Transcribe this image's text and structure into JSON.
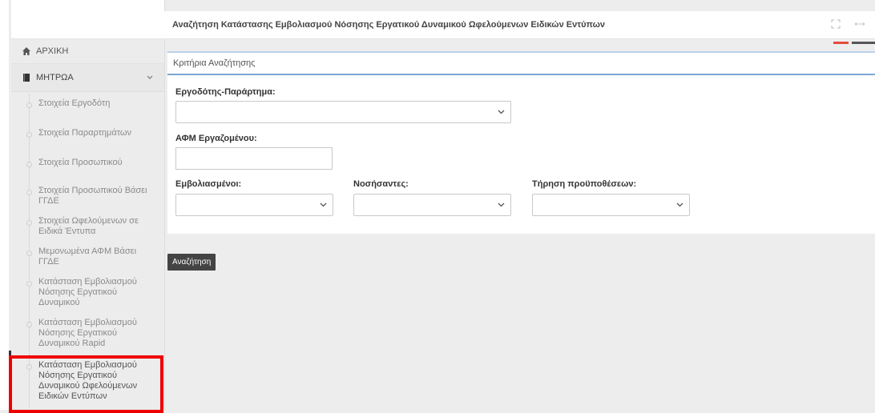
{
  "header": {
    "title": "Αναζήτηση Κατάστασης Εμβολιασμού Νόσησης Εργατικού Δυναμικού Ωφελούμενων Ειδικών Εντύπων",
    "icons": [
      "expand-icon",
      "arrows-horizontal-icon"
    ]
  },
  "sidebar": {
    "home_label": "ΑΡΧΙΚΗ",
    "registry_label": "ΜΗΤΡΩΑ",
    "items": [
      {
        "label": "Στοιχεία Εργοδότη"
      },
      {
        "label": "Στοιχεία Παραρτημάτων"
      },
      {
        "label": "Στοιχεία Προσωπικού"
      },
      {
        "label": "Στοιχεία Προσωπικού Βάσει ΓΓΔΕ"
      },
      {
        "label": "Στοιχεία Ωφελούμενων σε Ειδικά Έντυπα"
      },
      {
        "label": "Μεμονωμένα ΑΦΜ Βάσει ΓΓΔΕ"
      },
      {
        "label": "Κατάσταση Εμβολιασμού Νόσησης Εργατικού Δυναμικού"
      },
      {
        "label": "Κατάσταση Εμβολιασμού Νόσησης Εργατικού Δυναμικού Rapid"
      },
      {
        "label": "Κατάσταση Εμβολιασμού Νόσησης Εργατικού Δυναμικού Ωφελούμενων Ειδικών Εντύπων"
      }
    ],
    "highlight_color": "#ee0000"
  },
  "form": {
    "panel_title": "Κριτήρια Αναζήτησης",
    "employer_label": "Εργοδότης-Παράρτημα:",
    "employer_value": "",
    "afm_label": "ΑΦΜ Εργαζομένου:",
    "afm_value": "",
    "vaccinated_label": "Εμβολιασμένοι:",
    "vaccinated_value": "",
    "sick_label": "Νοσήσαντες:",
    "sick_value": "",
    "conditions_label": "Τήρηση προϋποθέσεων:",
    "conditions_value": "",
    "search_button": "Αναζήτηση"
  },
  "colors": {
    "accent_red": "#e74c3c",
    "panel_border": "#7fa6d3",
    "button_bg": "#444444"
  }
}
